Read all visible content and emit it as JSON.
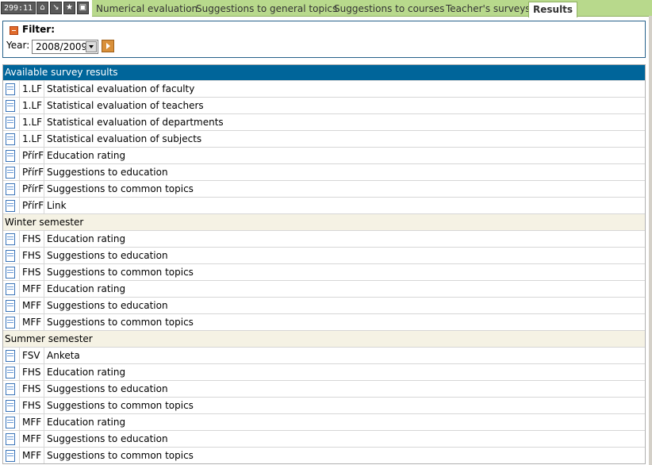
{
  "toolbar": {
    "counter": "299:11",
    "icons": [
      "home-icon",
      "arrow-icon",
      "star-icon",
      "print-icon"
    ]
  },
  "tabs": [
    {
      "label": "Numerical evaluation"
    },
    {
      "label": "Suggestions to general topics"
    },
    {
      "label": "Suggestions to courses"
    },
    {
      "label": "Teacher's surveys"
    },
    {
      "label": "Results",
      "active": true
    }
  ],
  "filter": {
    "title": "Filter:",
    "year_label": "Year:",
    "year_value": "2008/2009"
  },
  "results": {
    "header": "Available survey results",
    "general": [
      {
        "faculty": "1.LF",
        "name": "Statistical evaluation of faculty"
      },
      {
        "faculty": "1.LF",
        "name": "Statistical evaluation of teachers"
      },
      {
        "faculty": "1.LF",
        "name": "Statistical evaluation of departments"
      },
      {
        "faculty": "1.LF",
        "name": "Statistical evaluation of subjects"
      },
      {
        "faculty": "PřírF",
        "name": "Education rating"
      },
      {
        "faculty": "PřírF",
        "name": "Suggestions to education"
      },
      {
        "faculty": "PřírF",
        "name": "Suggestions to common topics"
      },
      {
        "faculty": "PřírF",
        "name": "Link"
      }
    ],
    "winter_title": "Winter semester",
    "winter": [
      {
        "faculty": "FHS",
        "name": "Education rating"
      },
      {
        "faculty": "FHS",
        "name": "Suggestions to education"
      },
      {
        "faculty": "FHS",
        "name": "Suggestions to common topics"
      },
      {
        "faculty": "MFF",
        "name": "Education rating"
      },
      {
        "faculty": "MFF",
        "name": "Suggestions to education"
      },
      {
        "faculty": "MFF",
        "name": "Suggestions to common topics"
      }
    ],
    "summer_title": "Summer semester",
    "summer": [
      {
        "faculty": "FSV",
        "name": "Anketa"
      },
      {
        "faculty": "FHS",
        "name": "Education rating"
      },
      {
        "faculty": "FHS",
        "name": "Suggestions to education"
      },
      {
        "faculty": "FHS",
        "name": "Suggestions to common topics"
      },
      {
        "faculty": "MFF",
        "name": "Education rating"
      },
      {
        "faculty": "MFF",
        "name": "Suggestions to education"
      },
      {
        "faculty": "MFF",
        "name": "Suggestions to common topics"
      }
    ]
  }
}
